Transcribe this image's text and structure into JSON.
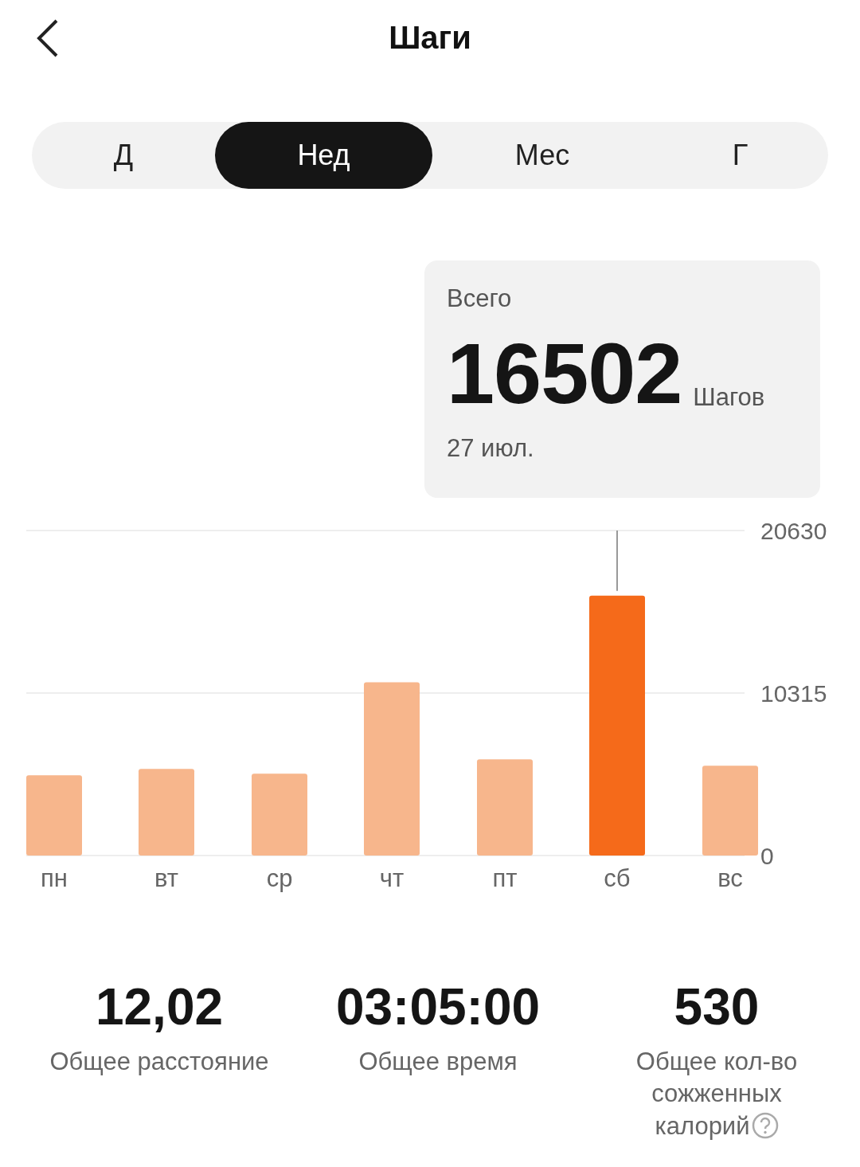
{
  "header": {
    "title": "Шаги"
  },
  "tabs": [
    {
      "label": "Д",
      "selected": false
    },
    {
      "label": "Нед",
      "selected": true
    },
    {
      "label": "Мес",
      "selected": false
    },
    {
      "label": "Г",
      "selected": false
    }
  ],
  "summary": {
    "label": "Всего",
    "value": "16502",
    "unit": "Шагов",
    "date": "27 июл."
  },
  "chart": {
    "chart_data": {
      "type": "bar",
      "categories": [
        "пн",
        "вт",
        "ср",
        "чт",
        "пт",
        "сб",
        "вс"
      ],
      "series": [
        {
          "color": "#f7b68c",
          "values": [
            5100,
            5500,
            5200,
            11000,
            6100,
            null,
            5700
          ]
        },
        {
          "color": "#f56a1a",
          "values": [
            null,
            null,
            null,
            null,
            null,
            16500,
            null
          ]
        }
      ],
      "stacked": true,
      "ylim": [
        0,
        20630
      ],
      "yticks": [
        0,
        10315,
        20630
      ]
    }
  },
  "stats": [
    {
      "value": "12,02",
      "label": "Общее расстояние",
      "help": false
    },
    {
      "value": "03:05:00",
      "label": "Общее время",
      "help": false
    },
    {
      "value": "530",
      "label": "Общее кол-во сожженных калорий",
      "help": true
    }
  ]
}
